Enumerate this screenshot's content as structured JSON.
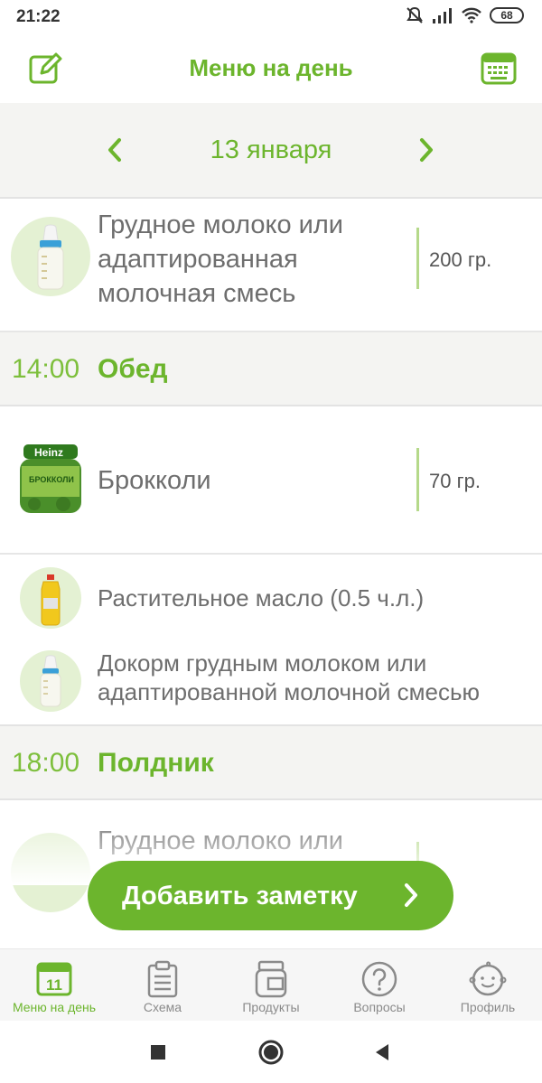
{
  "status": {
    "time": "21:22",
    "battery": "68"
  },
  "header": {
    "title": "Меню на день",
    "edit_icon": "pencil-icon",
    "calendar_icon": "keyboard-calendar-icon"
  },
  "date_nav": {
    "date": "13 января",
    "prev_icon": "chevron-left-icon",
    "next_icon": "chevron-right-icon"
  },
  "items": {
    "first": {
      "name_line1": "Грудное молоко или",
      "name_line2": "адаптированная",
      "name_line3": "молочная смесь",
      "amount": "200 гр.",
      "icon": "baby-bottle-icon"
    },
    "lunch": {
      "time": "14:00",
      "name": "Обед"
    },
    "broccoli": {
      "name": "Брокколи",
      "amount": "70 гр.",
      "icon": "baby-food-jar-icon",
      "jar_brand": "Heinz",
      "jar_label": "БРОККОЛИ"
    },
    "oil": {
      "name": "Растительное масло (0.5 ч.л.)",
      "icon": "oil-bottle-icon"
    },
    "supplement": {
      "line1": "Докорм грудным молоком или",
      "line2": "адаптированной молочной смесью",
      "icon": "baby-bottle-icon"
    },
    "snack": {
      "time": "18:00",
      "name": "Полдник"
    },
    "snack_item": {
      "name_line1": "Грудное молоко или"
    }
  },
  "add_note": {
    "label": "Добавить заметку"
  },
  "bottom_nav": [
    {
      "label": "Меню на день",
      "icon": "calendar-day-icon",
      "badge": "11",
      "active": true
    },
    {
      "label": "Схема",
      "icon": "clipboard-icon",
      "active": false
    },
    {
      "label": "Продукты",
      "icon": "jar-icon",
      "active": false
    },
    {
      "label": "Вопросы",
      "icon": "question-icon",
      "active": false
    },
    {
      "label": "Профиль",
      "icon": "baby-face-icon",
      "active": false
    }
  ],
  "colors": {
    "accent": "#6cb52d",
    "text": "#6e6e6e",
    "band": "#f4f4f2"
  }
}
